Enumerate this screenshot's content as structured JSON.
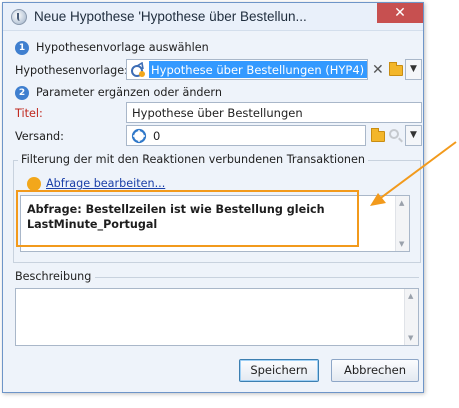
{
  "window": {
    "title": "Neue Hypothese 'Hypothese über Bestellun...",
    "close_glyph": "✕"
  },
  "step1": {
    "number": "1",
    "label": "Hypothesenvorlage auswählen",
    "template_label": "Hypothesenvorlage:",
    "template_value": "Hypothese über Bestellungen (HYP4)"
  },
  "step2": {
    "number": "2",
    "label": "Parameter ergänzen oder ändern",
    "title_label": "Titel:",
    "title_value": "Hypothese über Bestellungen",
    "shipping_label": "Versand:",
    "shipping_value": "0"
  },
  "filter": {
    "group_title": "Filterung der mit den Reaktionen verbundenen Transaktionen",
    "edit_link": "Abfrage bearbeiten...",
    "query_line1": "Abfrage: Bestellzeilen ist wie Bestellung gleich",
    "query_line2": "LastMinute_Portugal"
  },
  "description": {
    "group_title": "Beschreibung"
  },
  "buttons": {
    "save": "Speichern",
    "cancel": "Abbrechen"
  },
  "colors": {
    "title_label_red": "#c0281e",
    "highlight_orange": "#f29a1c",
    "selection_blue": "#3399ff",
    "close_red": "#c75050"
  },
  "icons": {
    "step": "step-number-icon",
    "template": "hypothesis-template-icon",
    "shipping": "delivery-icon",
    "folder": "folder-icon",
    "clear": "close-icon",
    "search": "search-icon",
    "dropdown": "chevron-down-icon",
    "query": "query-icon"
  }
}
